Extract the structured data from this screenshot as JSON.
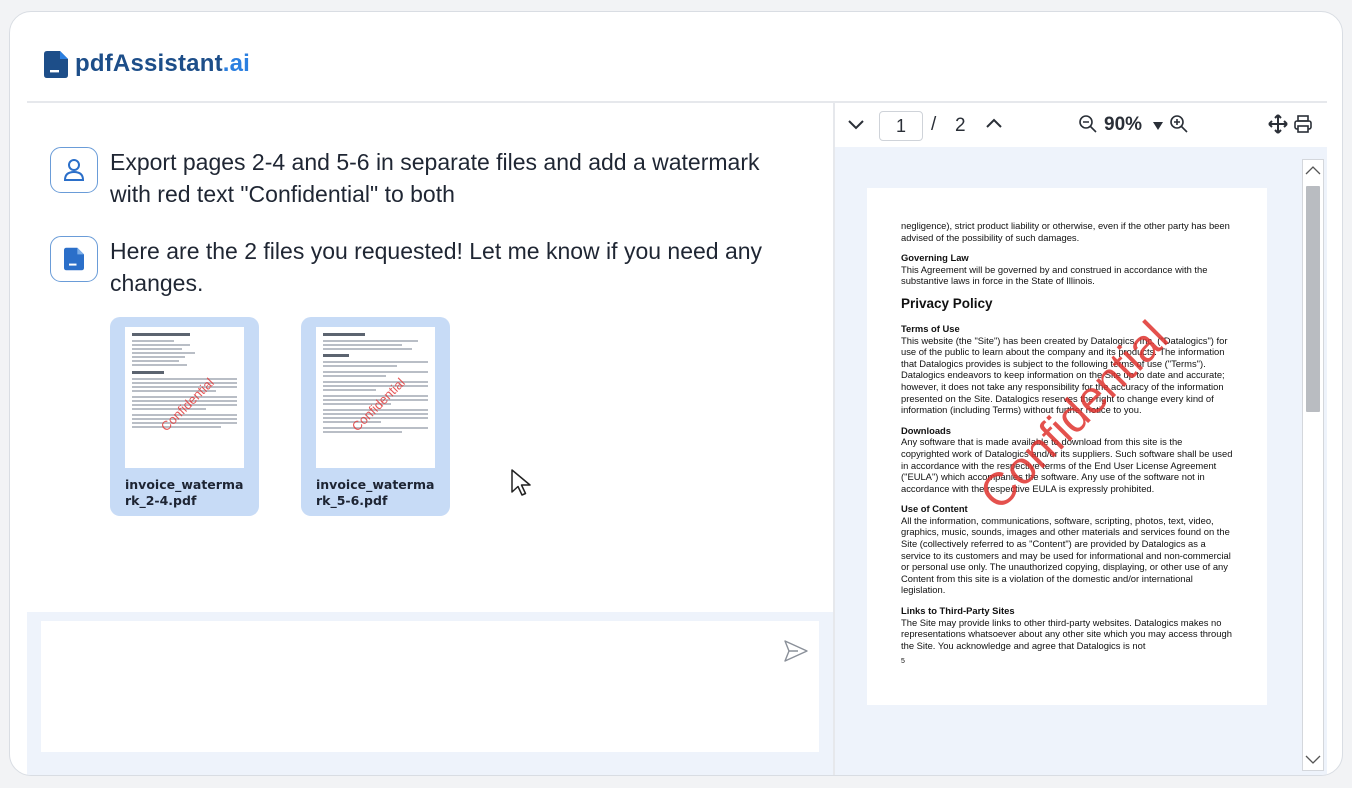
{
  "brand": {
    "name_prefix": "pdf",
    "name_main": "Assistant",
    "name_suffix": ".ai",
    "color": "#1d4e89",
    "accent": "#2b7fe0"
  },
  "chat": {
    "user_message": "Export pages 2-4 and 5-6 in separate files and add a watermark with red text \"Confidential\" to both",
    "assistant_message": "Here are the 2 files you requested! Let me know if you need any changes.",
    "files": [
      {
        "name": "invoice_watermark_2-4.pdf",
        "thumb_watermark": "Confidential"
      },
      {
        "name": "invoice_watermark_5-6.pdf",
        "thumb_watermark": "Confidential"
      }
    ],
    "input": {
      "value": "",
      "placeholder": ""
    }
  },
  "viewer": {
    "current_page": "1",
    "separator": "/",
    "total_pages": "2",
    "zoom": "90%",
    "watermark": "Confidential",
    "document": {
      "intro": "negligence), strict product liability or otherwise, even if the other party has been advised of the possibility of such damages.",
      "sections_top": [
        {
          "heading": "Governing Law",
          "body": "This Agreement will be governed by and construed in accordance with the substantive laws in force in the State of Illinois."
        }
      ],
      "title": "Privacy Policy",
      "sections": [
        {
          "heading": "Terms of Use",
          "body": "This website (the \"Site\") has been created by Datalogics, Inc. (\"Datalogics\") for use of the public to learn about the company and its products. The information that Datalogics provides is subject to the following terms of use (\"Terms\"). Datalogics endeavors to keep information on the Site up to date and accurate; however, it does not take any responsibility for the accuracy of the information presented on the Site. Datalogics reserves the right to change every kind of information (including Terms) without further notice to you."
        },
        {
          "heading": "Downloads",
          "body": "Any software that is made available to download from this site is the copyrighted work of Datalogics and/or its suppliers. Such software shall be used in accordance with the respective terms of the End User License Agreement (\"EULA\") which accompanies the software. Any use of the software not in accordance with the respective EULA is expressly prohibited."
        },
        {
          "heading": "Use of Content",
          "body": "All the information, communications, software, scripting, photos, text, video, graphics, music, sounds, images and other materials and services found on the Site (collectively referred to as \"Content\") are provided by Datalogics as a service to its customers and may be used for informational and non-commercial or personal use only. The unauthorized copying, displaying, or other use of any Content from this site is a violation of the domestic and/or international legislation."
        },
        {
          "heading": "Links to Third-Party Sites",
          "body": "The Site may provide links to other third-party websites. Datalogics makes no representations whatsoever about any other site which you may access through the Site. You acknowledge and agree that Datalogics is not"
        }
      ],
      "page_number": "5"
    }
  }
}
